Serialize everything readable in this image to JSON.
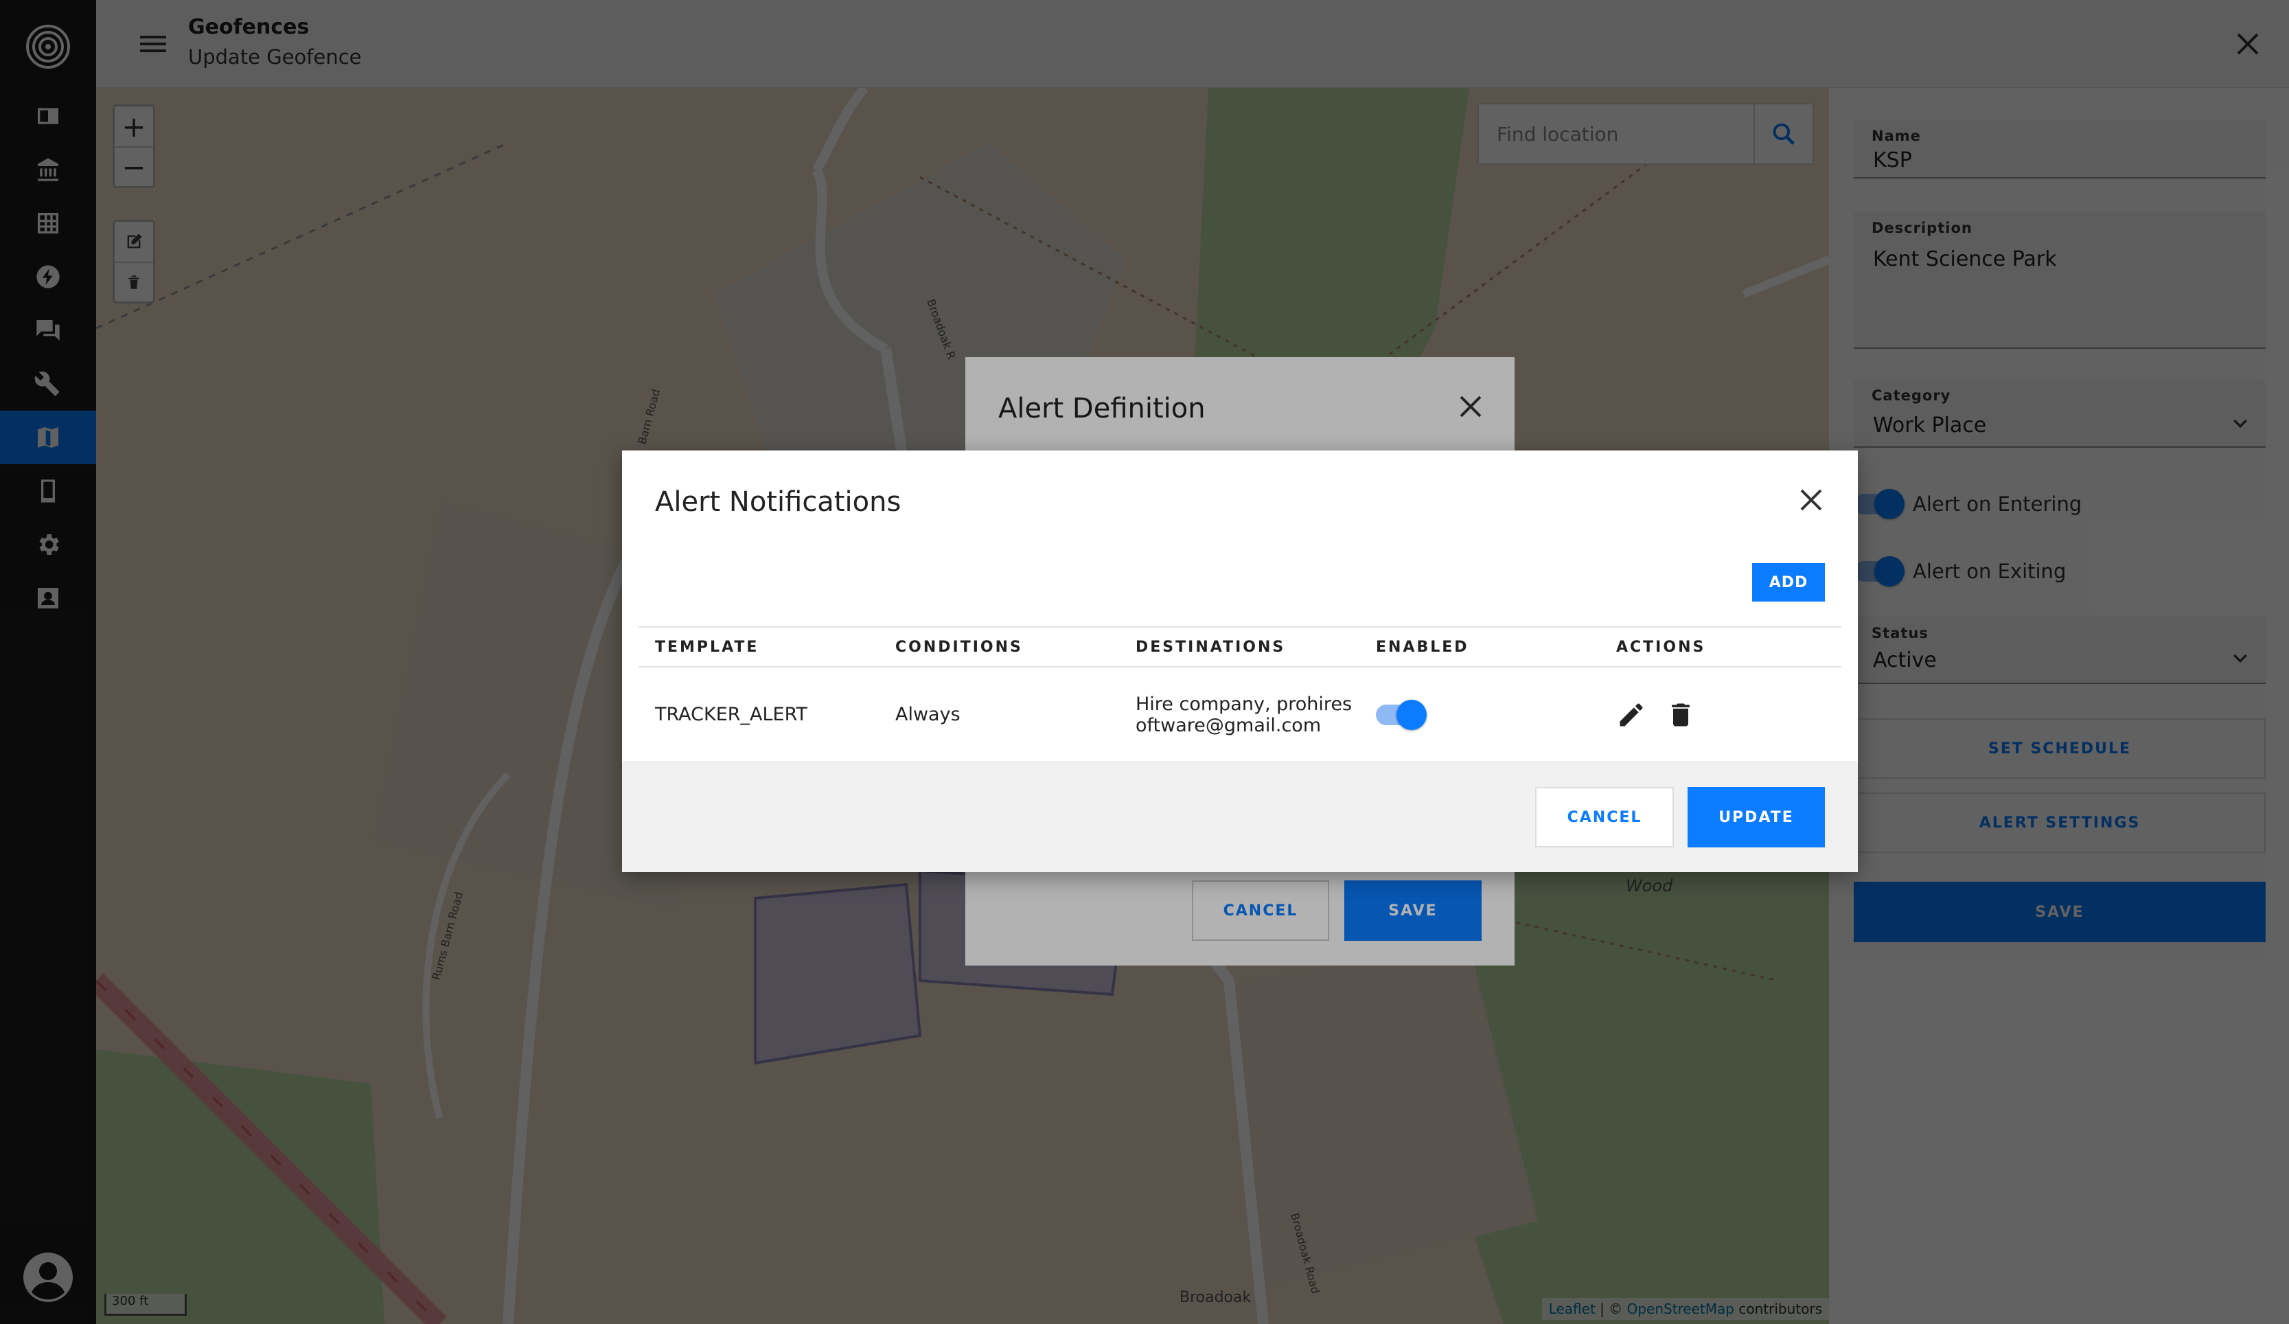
{
  "header": {
    "title": "Geofences",
    "subtitle": "Update Geofence"
  },
  "sidebar": {
    "items": [
      {
        "icon": "dashboard-icon",
        "active": false
      },
      {
        "icon": "bank-icon",
        "active": false
      },
      {
        "icon": "grid-icon",
        "active": false
      },
      {
        "icon": "bolt-icon",
        "active": false
      },
      {
        "icon": "chat-icon",
        "active": false
      },
      {
        "icon": "wrench-icon",
        "active": false
      },
      {
        "icon": "map-icon",
        "active": true
      },
      {
        "icon": "device-icon",
        "active": false
      },
      {
        "icon": "gear-icon",
        "active": false
      },
      {
        "icon": "contact-icon",
        "active": false
      }
    ]
  },
  "map": {
    "search_placeholder": "Find location",
    "zoom_in": "+",
    "zoom_out": "−",
    "scale": "300 ft",
    "attribution": {
      "leaflet": "Leaflet",
      "sep": " | © ",
      "osm": "OpenStreetMap",
      "suffix": " contributors"
    },
    "labels": {
      "broadoak": "Broadoak",
      "wood": "Wood",
      "broadoak_road": "Broadoak Road",
      "rums_barn_road": "Rums Barn Road",
      "barn_road": "Barn Road",
      "broadoak_r": "Broadoak R"
    }
  },
  "panel": {
    "name_label": "Name",
    "name_value": "KSP",
    "description_label": "Description",
    "description_value": "Kent Science Park",
    "category_label": "Category",
    "category_value": "Work Place",
    "alert_entering": "Alert on Entering",
    "alert_exiting": "Alert on Exiting",
    "status_label": "Status",
    "status_value": "Active",
    "set_schedule": "SET SCHEDULE",
    "alert_settings": "ALERT SETTINGS",
    "save": "SAVE"
  },
  "alert_definition": {
    "title": "Alert Definition",
    "cancel": "CANCEL",
    "save": "SAVE"
  },
  "alert_notifications": {
    "title": "Alert Notifications",
    "add": "ADD",
    "columns": [
      "TEMPLATE",
      "CONDITIONS",
      "DESTINATIONS",
      "ENABLED",
      "ACTIONS"
    ],
    "rows": [
      {
        "template": "TRACKER_ALERT",
        "conditions": "Always",
        "destinations_line1": "Hire company, prohires",
        "destinations_line2": "oftware@gmail.com",
        "enabled": true
      }
    ],
    "cancel": "CANCEL",
    "update": "UPDATE"
  },
  "colors": {
    "accent": "#0b7cff",
    "sidebar": "#1c1c1c"
  }
}
